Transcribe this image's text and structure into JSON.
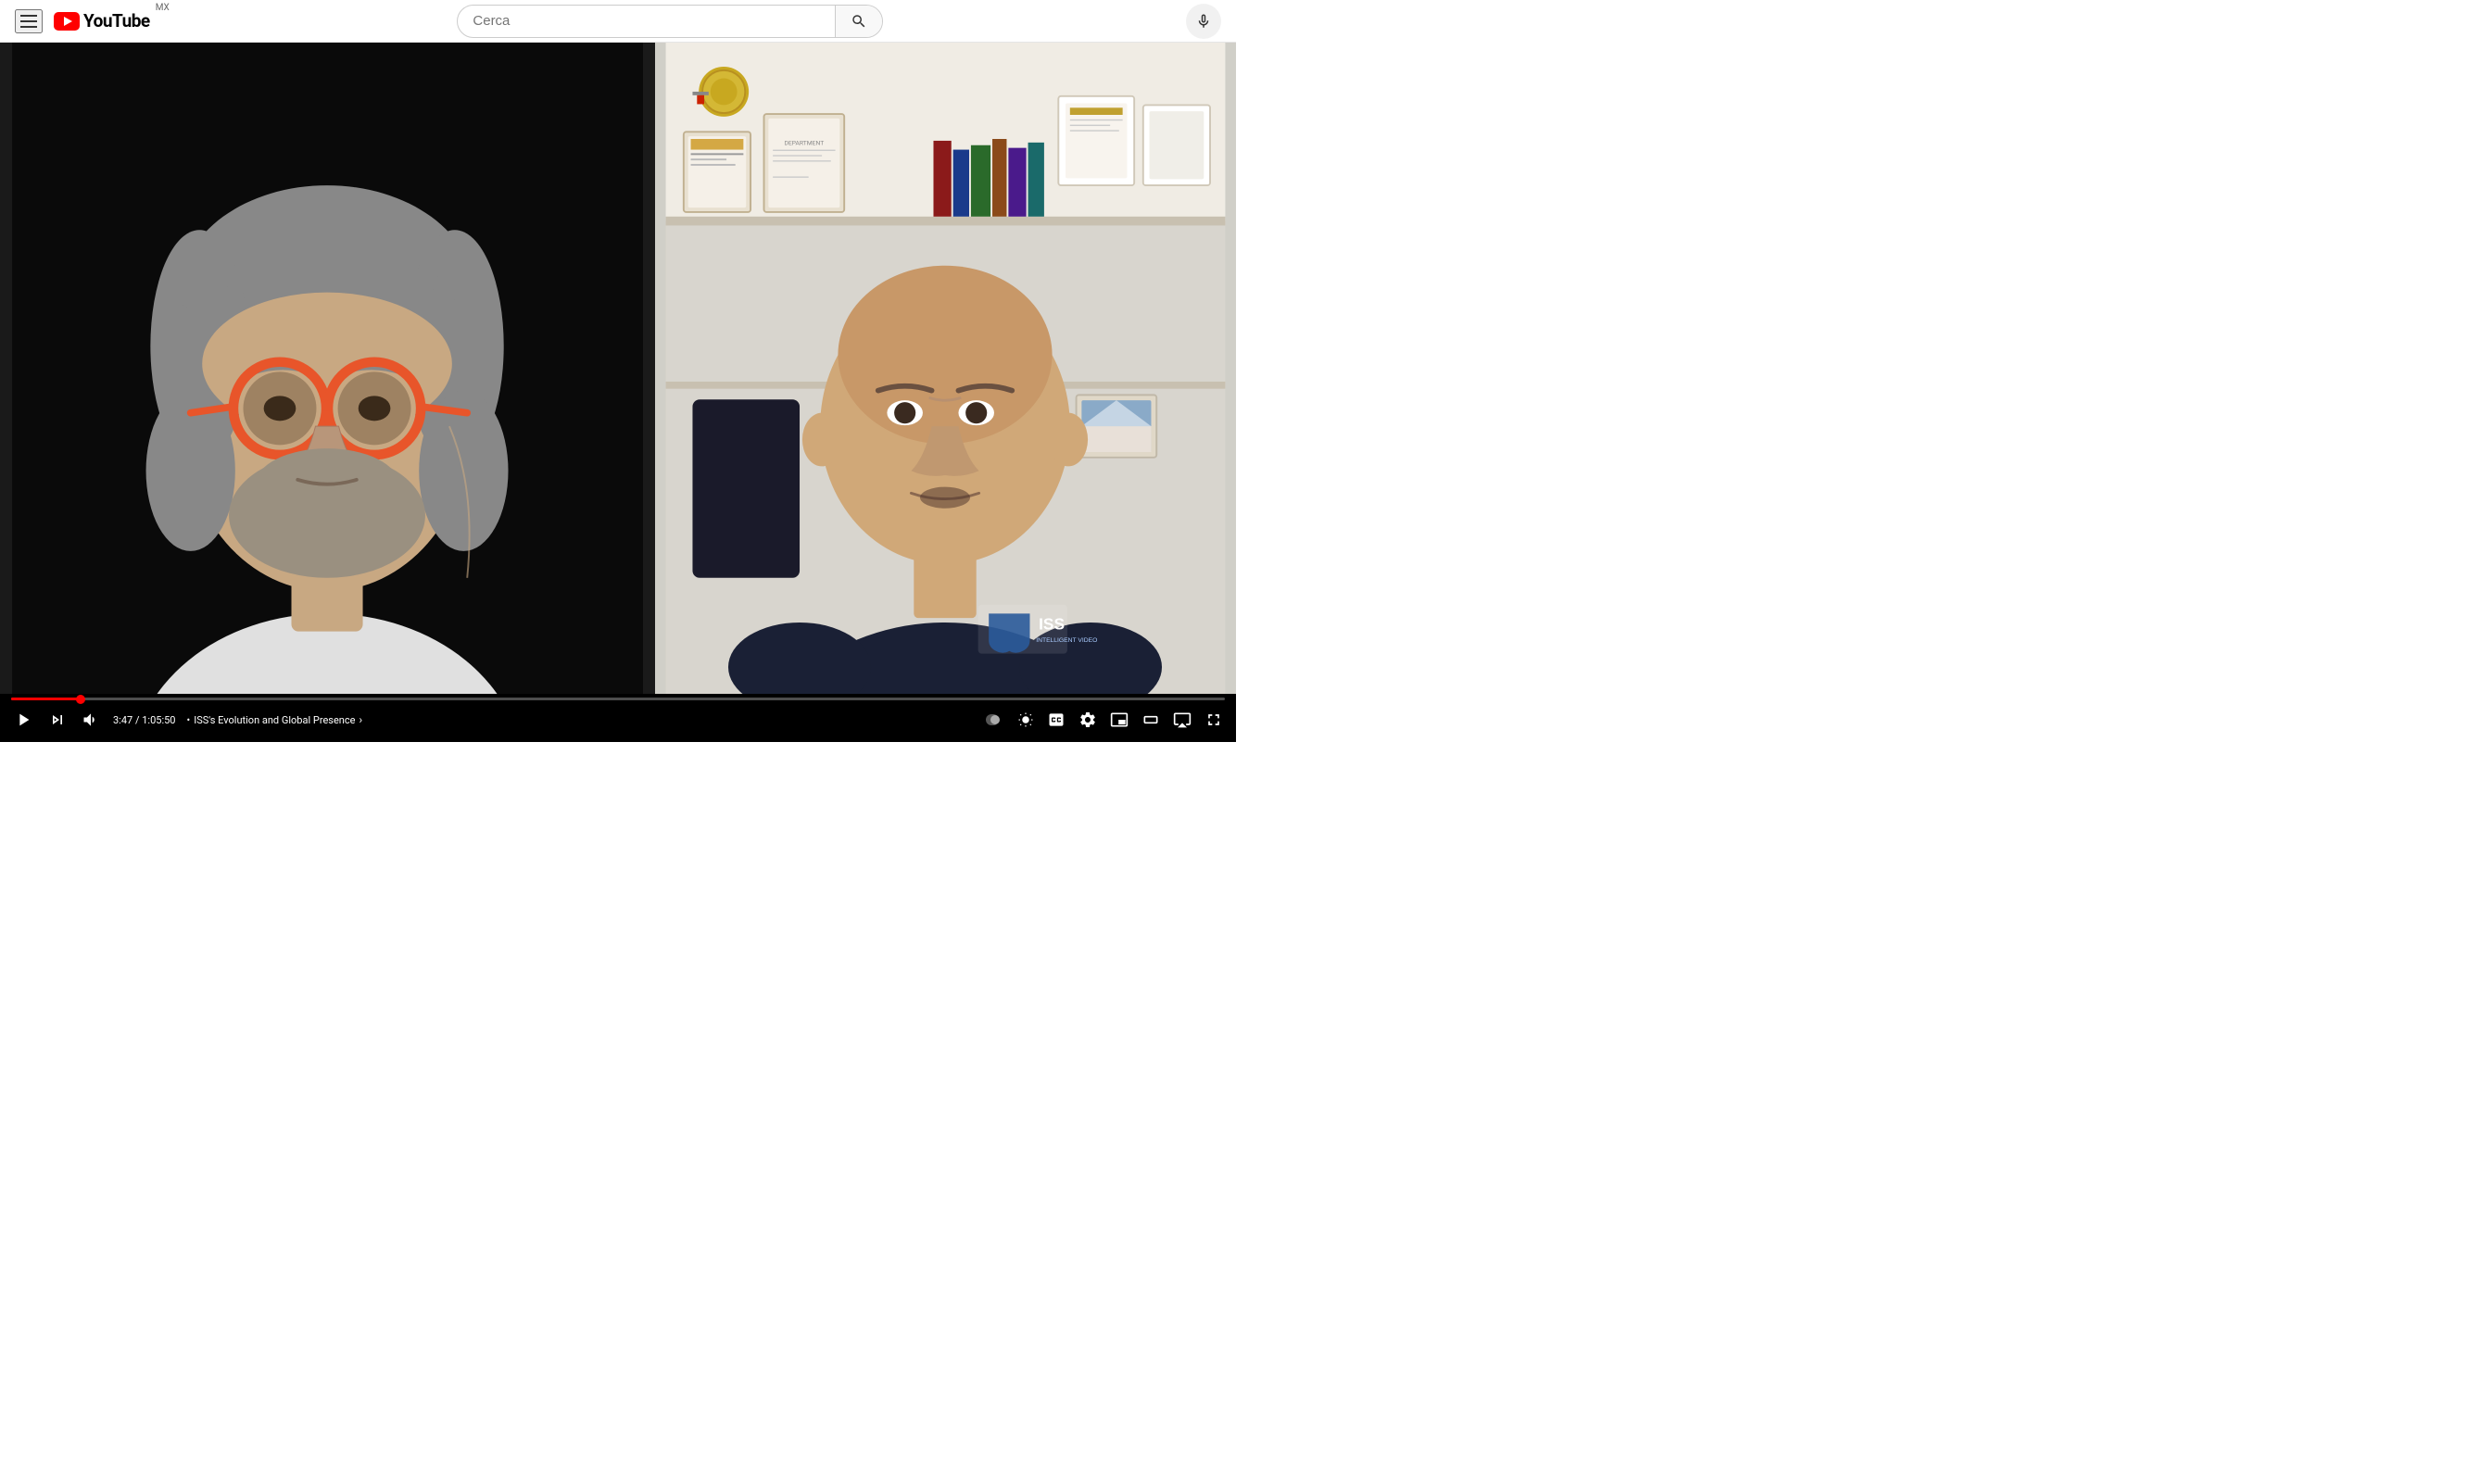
{
  "header": {
    "menu_label": "Menu",
    "logo_text": "YouTube",
    "region": "MX",
    "search_placeholder": "Cerca"
  },
  "video": {
    "current_time": "3:47",
    "total_time": "1:05:50",
    "chapter": "ISS's Evolution and Global Presence",
    "progress_percent": 5.7,
    "controls": {
      "play_label": "Play",
      "next_label": "Next",
      "volume_label": "Volume",
      "miniplayer_label": "Miniplayer",
      "settings_label": "Settings",
      "theater_label": "Theater mode",
      "fullscreen_label": "Fullscreen",
      "captions_label": "Subtitles",
      "ambient_label": "Ambient mode",
      "airplay_label": "AirPlay"
    }
  }
}
